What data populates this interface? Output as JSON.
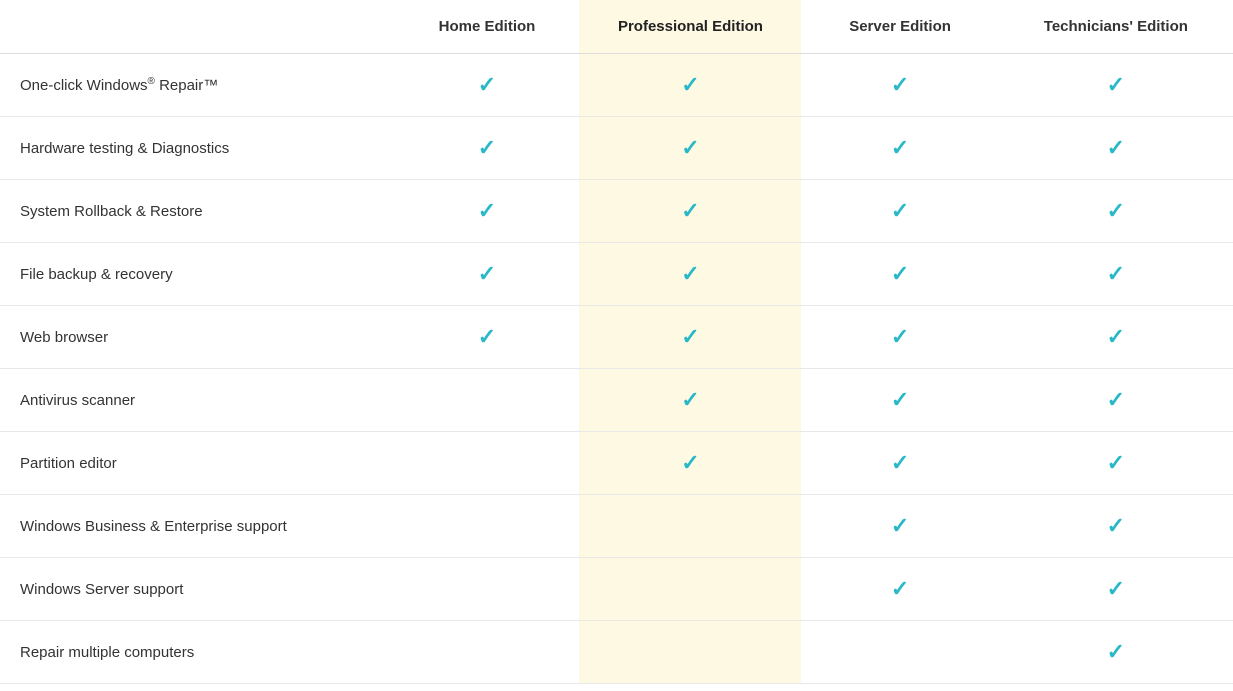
{
  "table": {
    "columns": [
      {
        "id": "feature",
        "label": "",
        "highlight": false
      },
      {
        "id": "home",
        "label": "Home Edition",
        "highlight": false
      },
      {
        "id": "pro",
        "label": "Professional Edition",
        "highlight": true
      },
      {
        "id": "server",
        "label": "Server Edition",
        "highlight": false
      },
      {
        "id": "tech",
        "label": "Technicians' Edition",
        "highlight": false
      }
    ],
    "rows": [
      {
        "feature": "One-click Windows® Repair™",
        "feature_html": true,
        "home": true,
        "pro": true,
        "server": true,
        "tech": true
      },
      {
        "feature": "Hardware testing & Diagnostics",
        "home": true,
        "pro": true,
        "server": true,
        "tech": true
      },
      {
        "feature": "System Rollback & Restore",
        "home": true,
        "pro": true,
        "server": true,
        "tech": true
      },
      {
        "feature": "File backup & recovery",
        "home": true,
        "pro": true,
        "server": true,
        "tech": true
      },
      {
        "feature": "Web browser",
        "home": true,
        "pro": true,
        "server": true,
        "tech": true
      },
      {
        "feature": "Antivirus scanner",
        "home": false,
        "pro": true,
        "server": true,
        "tech": true
      },
      {
        "feature": "Partition editor",
        "home": false,
        "pro": true,
        "server": true,
        "tech": true
      },
      {
        "feature": "Windows Business & Enterprise support",
        "home": false,
        "pro": false,
        "server": true,
        "tech": true
      },
      {
        "feature": "Windows Server support",
        "home": false,
        "pro": false,
        "server": true,
        "tech": true
      },
      {
        "feature": "Repair multiple computers",
        "home": false,
        "pro": false,
        "server": false,
        "tech": true
      }
    ],
    "check_symbol": "✓"
  }
}
